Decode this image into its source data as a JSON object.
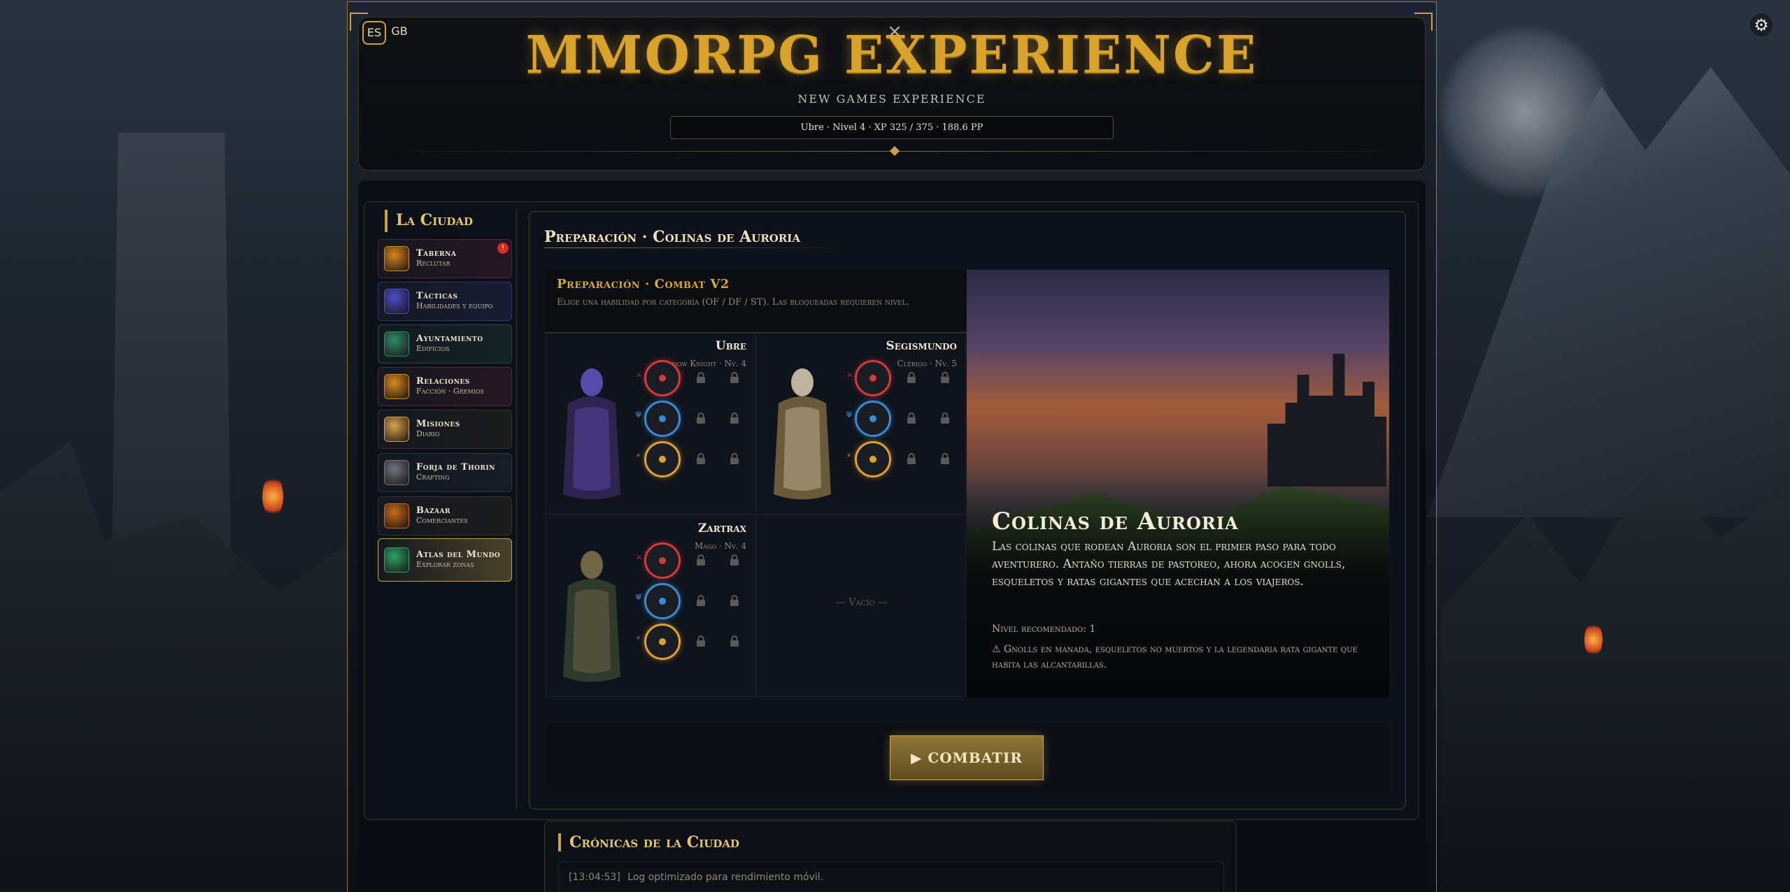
{
  "header": {
    "lang_active": "ES",
    "lang_other": "GB",
    "close": "×",
    "title": "MMORPG EXPERIENCE",
    "subtitle": "NEW GAMES EXPERIENCE",
    "status": "Ubre · Nivel 4 · XP 325 / 375 · 188.6 PP"
  },
  "settings_icon": "gear-icon",
  "sidebar": {
    "title": "La Ciudad",
    "items": [
      {
        "title": "Taberna",
        "sub": "Reclutar",
        "icon": "tavern-icon",
        "badge": "!",
        "color": "#d9861e",
        "border": "#5a2436"
      },
      {
        "title": "Tácticas",
        "sub": "Habilidades y equipo",
        "icon": "tactics-icon",
        "color": "#4a4fd0",
        "border": "#2e3570"
      },
      {
        "title": "Ayuntamiento",
        "sub": "Edificios",
        "icon": "townhall-icon",
        "color": "#2f8a6f",
        "border": "#1f4a40"
      },
      {
        "title": "Relaciones",
        "sub": "Facción · Gremios",
        "icon": "relations-icon",
        "color": "#d98a1e",
        "border": "#5a2436"
      },
      {
        "title": "Misiones",
        "sub": "Diario",
        "icon": "quest-icon",
        "color": "#d9a24a",
        "border": "#3b3325"
      },
      {
        "title": "Forja de Thorin",
        "sub": "Crafting",
        "icon": "forge-icon",
        "color": "#6e7582",
        "border": "#2e3440"
      },
      {
        "title": "Bazaar",
        "sub": "Comerciantes",
        "icon": "bazaar-icon",
        "color": "#c86a1a",
        "border": "#3b3325"
      },
      {
        "title": "Atlas del Mundo",
        "sub": "Explorar zonas",
        "icon": "atlas-icon",
        "color": "#2aa36a",
        "border": "#c9a24a"
      }
    ]
  },
  "prep": {
    "title": "Preparación · Colinas de Auroria",
    "combat_title": "Preparación · Combat V2",
    "combat_desc": "Elige una habilidad por categoría (OF / DF / ST). Las bloqueadas requieren nivel.",
    "party": [
      {
        "name": "Ubre",
        "class": "Shadow Knight · Nv. 4",
        "skills": [
          "#d33a3a",
          "#3a8ad3",
          "#e0a030"
        ]
      },
      {
        "name": "Segismundo",
        "class": "Clérigo · Nv. 5",
        "skills": [
          "#d33a3a",
          "#3a8ad3",
          "#e0a030"
        ]
      },
      {
        "name": "Zartrax",
        "class": "Mago · Nv. 4",
        "skills": [
          "#d33a3a",
          "#3a8ad3",
          "#e0a030"
        ]
      }
    ],
    "skill_labels": [
      "⚔",
      "⛨",
      "⚡"
    ],
    "empty_slot": "— Vacío —"
  },
  "zone": {
    "name": "Colinas de Auroria",
    "description": "Las colinas que rodean Auroria son el primer paso para todo aventurero. Antaño tierras de pastoreo, ahora acogen gnolls, esqueletos y ratas gigantes que acechan a los viajeros.",
    "level": "Nivel recomendado: 1",
    "warning": "⚠ Gnolls en manada, esqueletos no muertos y la legendaria rata gigante que habita las alcantarillas."
  },
  "fight_button": "▶ COMBATIR",
  "chronicles": {
    "title": "Crónicas de la Ciudad",
    "log": [
      {
        "time": "[13:04:53]",
        "text": "Log optimizado para rendimiento móvil."
      }
    ]
  }
}
